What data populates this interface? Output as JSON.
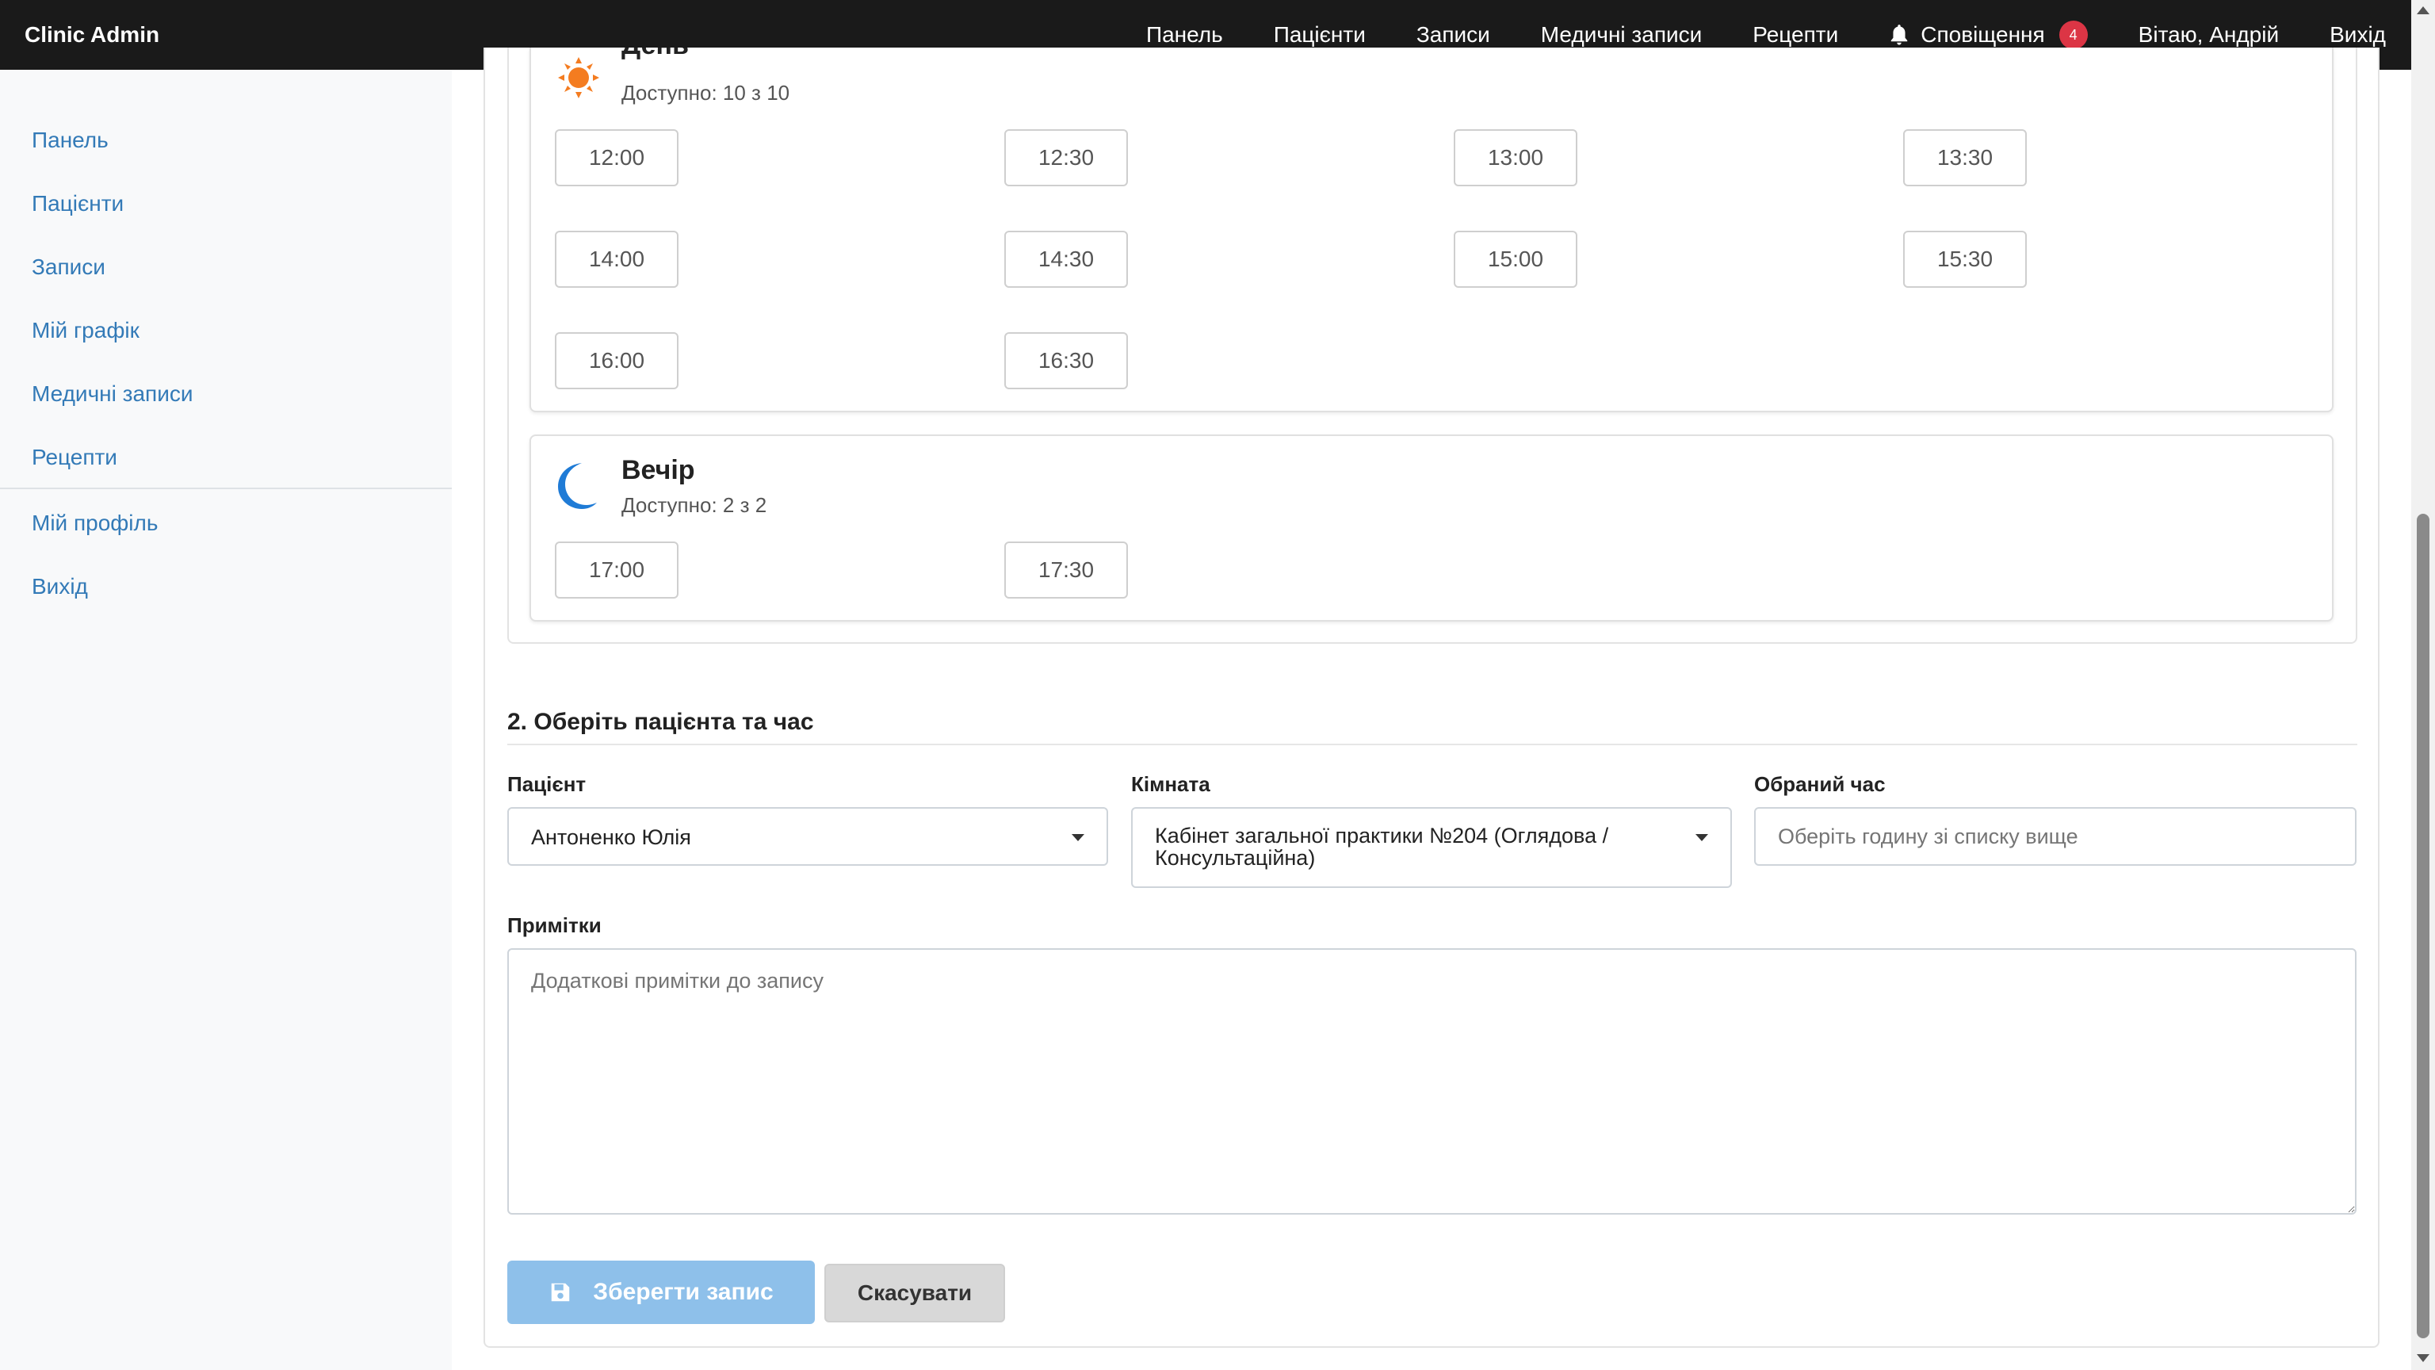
{
  "navbar": {
    "brand": "Clinic Admin",
    "links": [
      "Панель",
      "Пацієнти",
      "Записи",
      "Медичні записи",
      "Рецепти"
    ],
    "notifications_label": "Сповіщення",
    "notifications_count": "4",
    "greeting": "Вітаю, Андрій",
    "logout": "Вихід"
  },
  "sidebar": {
    "items": [
      "Панель",
      "Пацієнти",
      "Записи",
      "Мій графік",
      "Медичні записи",
      "Рецепти",
      "Мій профіль",
      "Вихід"
    ]
  },
  "day_period": {
    "title": "День",
    "availability": "Доступно: 10 з 10",
    "icon": "sun-icon",
    "slots": [
      "12:00",
      "12:30",
      "13:00",
      "13:30",
      "14:00",
      "14:30",
      "15:00",
      "15:30",
      "16:00",
      "16:30"
    ]
  },
  "evening_period": {
    "title": "Вечір",
    "availability": "Доступно: 2 з 2",
    "icon": "moon-icon",
    "slots": [
      "17:00",
      "17:30"
    ]
  },
  "form": {
    "section_title": "2. Оберіть пацієнта та час",
    "patient_label": "Пацієнт",
    "patient_value": "Антоненко Юлія",
    "room_label": "Кімната",
    "room_value_line1": "Кабінет загальної практики №204 (Оглядова /",
    "room_value_line2": "Консультаційна)",
    "time_label": "Обраний час",
    "time_placeholder": "Оберіть годину зі списку вище",
    "notes_label": "Примітки",
    "notes_placeholder": "Додаткові примітки до запису",
    "save_label": "Зберегти запис",
    "cancel_label": "Скасувати"
  },
  "colors": {
    "navbar_bg": "#1a1a1a",
    "link": "#337ab7",
    "badge": "#dc3545",
    "save_button": "#8ec0ea",
    "sun": "#f47c20",
    "moon": "#1f7bd6"
  }
}
